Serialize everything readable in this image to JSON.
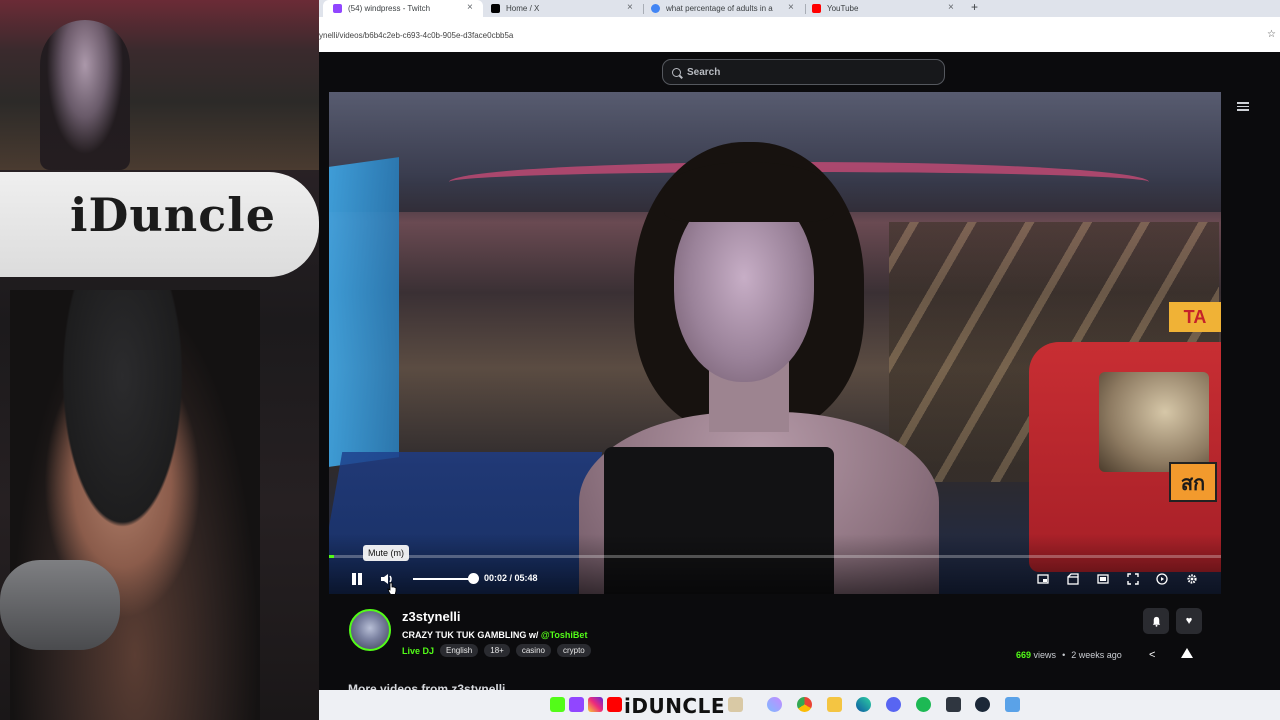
{
  "webcam": {
    "board_text": "iDuncle"
  },
  "tabs": [
    {
      "label": "(54) windpress - Twitch",
      "color": "#9146ff"
    },
    {
      "label": "Home / X",
      "color": "#000000"
    },
    {
      "label": "what percentage of adults in a",
      "color": "#4285f4"
    },
    {
      "label": "YouTube",
      "color": "#ff0000"
    }
  ],
  "url": "ynelli/videos/b6b4c2eb-c693-4c0b-905e-d3face0cbb5a",
  "search": {
    "placeholder": "Search"
  },
  "player": {
    "current_time": "00:02",
    "duration": "05:48",
    "time_display": "00:02 / 05:48",
    "progress_fraction": 0.006,
    "volume_fraction": 1.0,
    "tooltip": "Mute (m)"
  },
  "channel": {
    "name": "z3stynelli",
    "title_prefix": "CRAZY TUK TUK GAMBLING w/ ",
    "title_mention": "@ToshiBet",
    "category": "Live DJ",
    "tags": [
      "English",
      "18+",
      "casino",
      "crypto"
    ],
    "views_count": "669",
    "views_label": "views",
    "age": "2 weeks ago"
  },
  "more_videos": "More videos from z3stynelli",
  "taskbar": {
    "brand": "iDUNCLE"
  },
  "colors": {
    "accent": "#53fc18",
    "bg": "#0b0b0d"
  }
}
